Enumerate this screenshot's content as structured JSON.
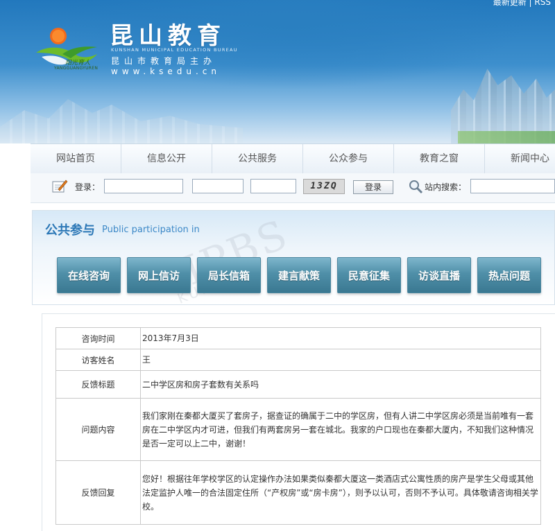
{
  "top_bar": {
    "latest": "最新更新",
    "sep": "|",
    "rss": "RSS"
  },
  "site": {
    "logo_sub": "YANGGUANGYUREN",
    "title": "昆山教育",
    "english": "KUNSHAN MUNICIPAL EDUCATION BUREAU",
    "host": "昆山市教育局主办",
    "url": "www.ksedu.cn"
  },
  "nav": [
    "网站首页",
    "信息公开",
    "公共服务",
    "公众参与",
    "教育之窗",
    "新闻中心"
  ],
  "login": {
    "label": "登录：",
    "captcha": "13ZQ",
    "button": "登录",
    "search_label": "站内搜索："
  },
  "section": {
    "title": "公共参与",
    "subtitle": "Public participation in",
    "watermark": "IPBS",
    "watermark_sub": "KUNSHAN",
    "buttons": [
      "在线咨询",
      "网上信访",
      "局长信箱",
      "建言献策",
      "民意征集",
      "访谈直播",
      "热点问题"
    ]
  },
  "detail": {
    "time_label": "咨询时间",
    "time": "2013年7月3日",
    "name_label": "访客姓名",
    "name": "王",
    "subject_label": "反馈标题",
    "subject": "二中学区房和房子套数有关系吗",
    "question_label": "问题内容",
    "question": "我们家刚在秦都大厦买了套房子，据查证的确属于二中的学区房，但有人讲二中学区房必须是当前唯有一套房在二中学区内才可进，但我们有两套房另一套在城北。我家的户口现也在秦都大厦内，不知我们这种情况是否一定可以上二中，谢谢！",
    "reply_label": "反馈回复",
    "reply": "您好！根据往年学校学区的认定操作办法如果类似秦都大厦这一类酒店式公寓性质的房产是学生父母或其他法定监护人唯一的合法固定住所（“产权房”或“房卡房”），则予以认可，否则不予认可。具体敬请咨询相关学校。"
  },
  "icons": [
    "logo-icon",
    "pen-icon",
    "magnifier-icon"
  ]
}
